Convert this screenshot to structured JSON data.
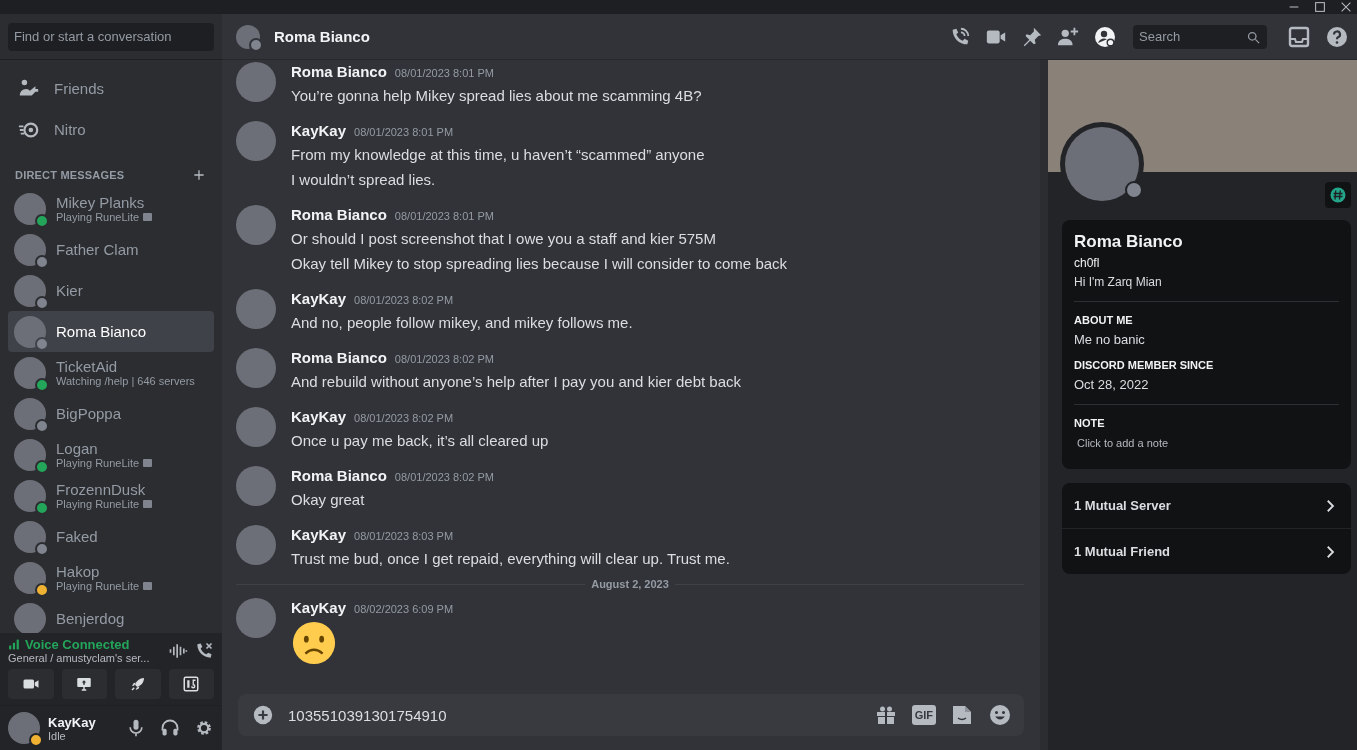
{
  "sidebar": {
    "search": {
      "placeholder": "Find or start a conversation"
    },
    "nav": [
      {
        "kind": "friends",
        "label": "Friends"
      },
      {
        "kind": "nitro",
        "label": "Nitro"
      }
    ],
    "dm_heading": "DIRECT MESSAGES",
    "dms": [
      {
        "name": "Mikey Planks",
        "activity": "Playing RuneLite",
        "color": "#23a55a",
        "selected": false
      },
      {
        "name": "Father Clam",
        "color": "#80848e",
        "selected": false
      },
      {
        "name": "Kier",
        "color": "#80848e",
        "selected": false
      },
      {
        "name": "Roma Bianco",
        "color": "#80848e",
        "selected": true
      },
      {
        "name": "TicketAid",
        "activity": "Watching /help | 646 servers",
        "color": "#23a55a",
        "selected": false
      },
      {
        "name": "BigPoppa",
        "color": "#80848e",
        "selected": false
      },
      {
        "name": "Logan",
        "activity": "Playing RuneLite",
        "color": "#23a55a",
        "selected": false
      },
      {
        "name": "FrozennDusk",
        "activity": "Playing RuneLite",
        "color": "#23a55a",
        "selected": false
      },
      {
        "name": "Faked",
        "color": "#80848e",
        "selected": false
      },
      {
        "name": "Hakop",
        "activity": "Playing RuneLite",
        "color": "#f0b232",
        "selected": false
      },
      {
        "name": "Benjerdog",
        "selected": false
      }
    ],
    "voice": {
      "title": "Voice Connected",
      "channel": "General / amustyclam's ser..."
    },
    "user": {
      "name": "KayKay",
      "status_text": "Idle",
      "color": "#f0b232"
    }
  },
  "header": {
    "title": "Roma Bianco",
    "search_placeholder": "Search",
    "profile_toggle_active": true
  },
  "messages": [
    {
      "kind": "message",
      "author": "Roma Bianco",
      "time": "08/01/2023 8:01 PM",
      "lines": [
        "You’re gonna help Mikey spread lies about me scamming 4B?"
      ]
    },
    {
      "kind": "message",
      "author": "KayKay",
      "time": "08/01/2023 8:01 PM",
      "lines": [
        "From my knowledge at this time, u haven’t “scammed” anyone",
        "I wouldn’t spread lies."
      ]
    },
    {
      "kind": "message",
      "author": "Roma Bianco",
      "time": "08/01/2023 8:01 PM",
      "lines": [
        "Or should I post screenshot that I owe you a staff and kier 575M",
        "Okay tell Mikey to stop spreading lies because I will consider to come back"
      ]
    },
    {
      "kind": "message",
      "author": "KayKay",
      "time": "08/01/2023 8:02 PM",
      "lines": [
        "And no, people follow mikey, and mikey follows me."
      ]
    },
    {
      "kind": "message",
      "author": "Roma Bianco",
      "time": "08/01/2023 8:02 PM",
      "lines": [
        "And rebuild without anyone’s help after I pay you and kier debt back"
      ]
    },
    {
      "kind": "message",
      "author": "KayKay",
      "time": "08/01/2023 8:02 PM",
      "lines": [
        "Once u pay me back, it’s all cleared up"
      ]
    },
    {
      "kind": "message",
      "author": "Roma Bianco",
      "time": "08/01/2023 8:02 PM",
      "lines": [
        "Okay great"
      ]
    },
    {
      "kind": "message",
      "author": "KayKay",
      "time": "08/01/2023 8:03 PM",
      "lines": [
        "Trust me bud, once I get repaid, everything will clear up. Trust me."
      ]
    },
    {
      "kind": "divider",
      "label": "August 2, 2023"
    },
    {
      "kind": "emoji",
      "author": "KayKay",
      "time": "08/02/2023 6:09 PM"
    }
  ],
  "composer": {
    "value": "1035510391301754910",
    "gif_label": "GIF"
  },
  "profile": {
    "name": "Roma Bianco",
    "username": "ch0fl",
    "pronouns": "Hi I'm Zarq Mian",
    "color": "#80848e",
    "sections": [
      {
        "heading": "ABOUT ME",
        "text": "Me no banic"
      },
      {
        "heading": "DISCORD MEMBER SINCE",
        "text": "Oct 28, 2022"
      }
    ],
    "note": {
      "heading": "NOTE",
      "placeholder": "Click to add a note"
    },
    "mutuals": [
      "1 Mutual Server",
      "1 Mutual Friend"
    ]
  }
}
